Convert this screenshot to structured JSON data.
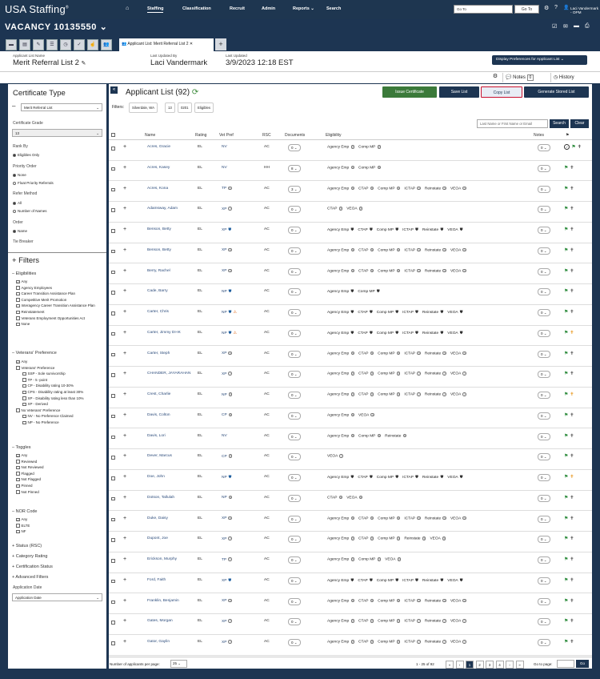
{
  "app": {
    "logo": "USA Staffing",
    "nav": [
      "Staffing",
      "Classification",
      "Recruit",
      "Admin",
      "Reports",
      "Search"
    ],
    "goto_placeholder": "Go To",
    "goto_button": "Go To",
    "user": "Laci Vandermark - OPM"
  },
  "vacancy": {
    "title": "VACANCY 10135550"
  },
  "tab": {
    "label": "Applicant List: Merit Referral List 2"
  },
  "info": {
    "list_name_label": "Applicant List Name",
    "list_name": "Merit Referral List 2",
    "updated_by_label": "Last Updated By",
    "updated_by": "Laci Vandermark",
    "updated_label": "Last Updated",
    "updated": "3/9/2023 12:18 EST",
    "display_prefs": "Display Preferences for Applicant List",
    "notes": "Notes",
    "notes_count": "0",
    "history": "History"
  },
  "sidebar": {
    "cert_type_title": "Certificate Type",
    "cert_type_value": "Merit Referral List",
    "cert_grade_label": "Certificate Grade",
    "cert_grade_value": "13",
    "rank_by_label": "Rank By",
    "rank_by_opts": [
      "Eligibles Only"
    ],
    "priority_label": "Priority Order",
    "priority_opts": [
      "None",
      "Float Priority Referrals"
    ],
    "refer_label": "Refer Method",
    "refer_opts": [
      "All",
      "Number of Names"
    ],
    "order_label": "Order",
    "order_opts": [
      "Name"
    ],
    "tiebreaker_label": "Tie Breaker",
    "filters_title": "+ Filters",
    "elig_title": "Eligibilities",
    "elig_opts": [
      "Any",
      "Agency Employees",
      "Career Transition Assistance Plan",
      "Competitive Merit Promotion",
      "Interagency Career Transition Assistance Plan",
      "Reinstatement",
      "Veterans Employment Opportunities Act",
      "None"
    ],
    "vet_title": "Veterans' Preference",
    "vet_opts": [
      "Any",
      "Veterans' Preference",
      "SSP - Sole survivorship",
      "TP - 5 -point",
      "CP - Disability rating 10-30%",
      "CPS - Disability rating at least 30%",
      "XP - Disability rating less than 10%",
      "XP - Derived",
      "No Veterans' Preference",
      "NV - No Preference Claimed",
      "NP - No Preference"
    ],
    "toggles_title": "Toggles",
    "toggles_opts": [
      "Any",
      "Reviewed",
      "Not Reviewed",
      "Flagged",
      "Not Flagged",
      "Pinned",
      "Not Pinned"
    ],
    "nor_title": "NOR Code",
    "nor_opts": [
      "Any",
      "ELTE",
      "NF"
    ],
    "collapsed": [
      "+ Status (RSC)",
      "+ Category Rating",
      "+ Certification Status",
      "+ Advanced Filters"
    ],
    "app_date_label": "Application Date",
    "app_date_value": "Application Date"
  },
  "main": {
    "title": "Applicant List (92)",
    "buttons": {
      "issue": "Issue Certificate",
      "save": "Save List",
      "copy": "Copy List",
      "generate": "Generate Stored List"
    },
    "filters_label": "Filters:",
    "chips": [
      "Silverdale, WA",
      "13",
      "0201",
      "Eligibles"
    ],
    "search_placeholder": "Last Name or First Name or Email",
    "search": "Search",
    "clear": "Clear",
    "columns": [
      "Name",
      "Rating",
      "Vet Pref",
      "RSC",
      "Documents",
      "Eligibility",
      "Notes"
    ],
    "rows": [
      {
        "name": "Acres, Gracie",
        "rating": "EL",
        "vet": "NV",
        "rsc": "AC",
        "docs": "0",
        "elig": "Agency Emp ? Comp MP ?",
        "notes": "0",
        "flag": "✓ ⚑ ✝"
      },
      {
        "name": "Acres, Kasey",
        "rating": "EL",
        "vet": "NV",
        "rsc": "HH",
        "docs": "8",
        "elig": "Agency Emp ? Comp MP ?",
        "notes": "0",
        "flag": "⚑ ✝"
      },
      {
        "name": "Acres, Kona",
        "rating": "EL",
        "vet": "TP ?",
        "rsc": "AC",
        "docs": "3",
        "elig": "Agency Emp ? CTAP ? Comp MP ? ICTAP ? Reinstate ? VEOA ?",
        "notes": "0",
        "flag": "⚑ ✝"
      },
      {
        "name": "Adamsway, Adam",
        "rating": "EL",
        "vet": "XP ?",
        "rsc": "AC",
        "docs": "0",
        "elig": "CTAP ? VEOA ?",
        "notes": "0",
        "flag": "⚑ ✝"
      },
      {
        "name": "Benson, Betty",
        "rating": "EL",
        "vet": "XP ⛉",
        "rsc": "AC",
        "docs": "0",
        "elig": "Agency Emp ⛉ CTAP ⛉ Comp MP ⛉ ICTAP ⛉ Reinstate ⛉ VEOA ⛉",
        "notes": "0",
        "flag": "⚑ ✝"
      },
      {
        "name": "Benson, Betty",
        "rating": "EL",
        "vet": "XP ?",
        "rsc": "AC",
        "docs": "0",
        "elig": "Agency Emp ? CTAP ? Comp MP ? ICTAP ? Reinstate ? VEOA ?",
        "notes": "0",
        "flag": "⚑ ✝"
      },
      {
        "name": "Berry, Rachel",
        "rating": "EL",
        "vet": "XP ?",
        "rsc": "AC",
        "docs": "0",
        "elig": "Agency Emp ? CTAP ? Comp MP ? ICTAP ? Reinstate ? VEOA ?",
        "notes": "0",
        "flag": "⚑ ✝"
      },
      {
        "name": "Cade, Barry",
        "rating": "EL",
        "vet": "NP ⛉",
        "rsc": "AC",
        "docs": "0",
        "elig": "Agency Emp ⛉ Comp MP ⛉",
        "notes": "0",
        "flag": "⚑ ✝"
      },
      {
        "name": "Carter, Chris",
        "rating": "EL",
        "vet": "NP ⛉ ⚠",
        "rsc": "AC",
        "docs": "0",
        "elig": "Agency Emp ⛉ CTAP ⛉ Comp MP ⛉ ICTAP ⛉ Reinstate ⛉ VEOA ⛉",
        "notes": "0",
        "flag": "⚑ ✝"
      },
      {
        "name": "Carter, Jimmy DI-IK",
        "rating": "EL",
        "vet": "NP ⛉ ⚠",
        "rsc": "AC",
        "docs": "0",
        "elig": "Agency Emp ⛉ CTAP ⛉ Comp MP ⛉ ICTAP ⛉ Reinstate ⛉ VEOA ⛉",
        "notes": "0",
        "flag": "⚑ ✝"
      },
      {
        "name": "Carter, Steph",
        "rating": "EL",
        "vet": "XP ?",
        "rsc": "AC",
        "docs": "0",
        "elig": "Agency Emp ? CTAP ? Comp MP ? ICTAP ? Reinstate ? VEOA ?",
        "notes": "0",
        "flag": "⚑ ✝"
      },
      {
        "name": "CHANDER, JAYARAHAN",
        "rating": "EL",
        "vet": "XP ?",
        "rsc": "AC",
        "docs": "0",
        "elig": "Agency Emp ? CTAP ? Comp MP ? ICTAP ? Reinstate ? VEOA ?",
        "notes": "0",
        "flag": "⚑ ✝"
      },
      {
        "name": "Crest, Charlie",
        "rating": "EL",
        "vet": "NP ?",
        "rsc": "AC",
        "docs": "0",
        "elig": "Agency Emp ? CTAP ? Comp MP ? ICTAP ? Reinstate ? VEOA ?",
        "notes": "0",
        "flag": "⚑ ✝"
      },
      {
        "name": "Davis, Colton",
        "rating": "EL",
        "vet": "CP ?",
        "rsc": "AC",
        "docs": "0",
        "elig": "Agency Emp ? VEOA ?",
        "notes": "0",
        "flag": "⚑ ✝"
      },
      {
        "name": "Davis, Lori",
        "rating": "EL",
        "vet": "NV",
        "rsc": "AC",
        "docs": "0",
        "elig": "Agency Emp ? Comp MP ? Reinstate ?",
        "notes": "0",
        "flag": "⚑ ✝"
      },
      {
        "name": "Dever, Marcus",
        "rating": "EL",
        "vet": "CP ?",
        "rsc": "AC",
        "docs": "0",
        "elig": "VEOA ?",
        "notes": "0",
        "flag": "⚑ ✝"
      },
      {
        "name": "Doe, John",
        "rating": "EL",
        "vet": "NP ⛉",
        "rsc": "AC",
        "docs": "0",
        "elig": "Agency Emp ⛉ CTAP ⛉ Comp MP ⛉ ICTAP ⛉ Reinstate ⛉ VEOA ⛉",
        "notes": "0",
        "flag": "⚑ ✝"
      },
      {
        "name": "Dotson, Tallulah",
        "rating": "EL",
        "vet": "NP ?",
        "rsc": "AC",
        "docs": "0",
        "elig": "CTAP ? VEOA ?",
        "notes": "0",
        "flag": "⚑ ✝"
      },
      {
        "name": "Duke, Daisy",
        "rating": "EL",
        "vet": "XP ?",
        "rsc": "AC",
        "docs": "0",
        "elig": "Agency Emp ? CTAP ? Comp MP ? ICTAP ? Reinstate ? VEOA ?",
        "notes": "0",
        "flag": "⚑ ✝"
      },
      {
        "name": "Dupont, Joe",
        "rating": "EL",
        "vet": "XP ?",
        "rsc": "AC",
        "docs": "0",
        "elig": "Agency Emp ? CTAP ? Comp MP ? Reinstate ? VEOA ?",
        "notes": "0",
        "flag": "⚑ ✝"
      },
      {
        "name": "Erickson, Murphy",
        "rating": "EL",
        "vet": "TP ?",
        "rsc": "AC",
        "docs": "0",
        "elig": "Agency Emp ? Comp MP ? VEOA ?",
        "notes": "0",
        "flag": "⚑ ✝"
      },
      {
        "name": "Ford, Faith",
        "rating": "EL",
        "vet": "XP ⛉",
        "rsc": "AC",
        "docs": "0",
        "elig": "Agency Emp ⛉ CTAP ⛉ Comp MP ⛉ ICTAP ⛉ Reinstate ⛉ VEOA ⛉",
        "notes": "0",
        "flag": "⚑ ✝"
      },
      {
        "name": "Franklin, Benjamin",
        "rating": "EL",
        "vet": "XP ?",
        "rsc": "AC",
        "docs": "0",
        "elig": "Agency Emp ? CTAP ? Comp MP ? ICTAP ? Reinstate ? VEOA ?",
        "notes": "0",
        "flag": "⚑ ✝"
      },
      {
        "name": "Gates, Morgan",
        "rating": "EL",
        "vet": "XP ?",
        "rsc": "AC",
        "docs": "0",
        "elig": "Agency Emp ? CTAP ? Comp MP ? ICTAP ? Reinstate ? VEOA ?",
        "notes": "0",
        "flag": "⚑ ✝"
      },
      {
        "name": "Gator, Gaylin",
        "rating": "EL",
        "vet": "XP ?",
        "rsc": "AC",
        "docs": "0",
        "elig": "Agency Emp ? CTAP ? Comp MP ? ICTAP ? Reinstate ? VEOA ?",
        "notes": "0",
        "flag": "⚑ ✝"
      }
    ],
    "per_page_label": "Number of applicants per page:",
    "per_page": "25",
    "range": "1 - 25 of 92",
    "pages": [
      "«",
      "‹",
      "1",
      "2",
      "3",
      "4",
      "›",
      "»"
    ],
    "goto_page_label": "Go to page:",
    "go": "Go"
  }
}
